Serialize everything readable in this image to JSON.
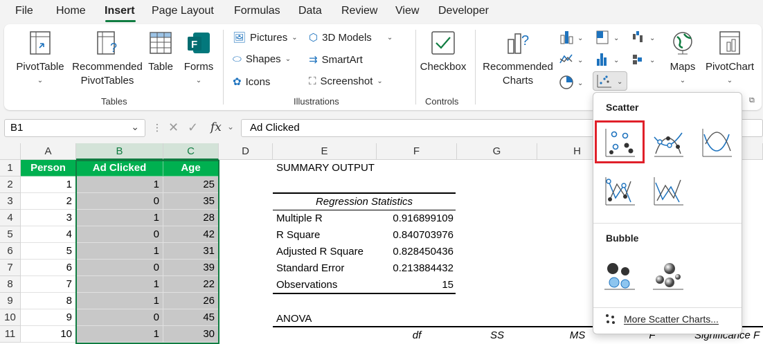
{
  "menu": {
    "tabs": [
      "File",
      "Home",
      "Insert",
      "Page Layout",
      "Formulas",
      "Data",
      "Review",
      "View",
      "Developer"
    ],
    "active": "Insert"
  },
  "ribbon": {
    "pivottable": "PivotTable",
    "rec_pivot_1": "Recommended",
    "rec_pivot_2": "PivotTables",
    "table": "Table",
    "forms": "Forms",
    "tables_group": "Tables",
    "pictures": "Pictures",
    "shapes": "Shapes",
    "icons": "Icons",
    "models": "3D Models",
    "smartart": "SmartArt",
    "screenshot": "Screenshot",
    "illustrations_group": "Illustrations",
    "checkbox": "Checkbox",
    "controls_group": "Controls",
    "rec_charts_1": "Recommended",
    "rec_charts_2": "Charts",
    "maps": "Maps",
    "pivotchart": "PivotChart"
  },
  "formula_bar": {
    "name_box": "B1",
    "fx": "fx",
    "formula": "Ad Clicked"
  },
  "columns": [
    "A",
    "B",
    "C",
    "D",
    "E",
    "F",
    "G",
    "H"
  ],
  "rows": [
    "1",
    "2",
    "3",
    "4",
    "5",
    "6",
    "7",
    "8",
    "9",
    "10",
    "11"
  ],
  "table": {
    "headers": [
      "Person",
      "Ad Clicked",
      "Age"
    ],
    "data": [
      [
        "1",
        "1",
        "25"
      ],
      [
        "2",
        "0",
        "35"
      ],
      [
        "3",
        "1",
        "28"
      ],
      [
        "4",
        "0",
        "42"
      ],
      [
        "5",
        "1",
        "31"
      ],
      [
        "6",
        "0",
        "39"
      ],
      [
        "7",
        "1",
        "22"
      ],
      [
        "8",
        "1",
        "26"
      ],
      [
        "9",
        "0",
        "45"
      ],
      [
        "10",
        "1",
        "30"
      ]
    ]
  },
  "summary": {
    "title": "SUMMARY OUTPUT",
    "reg_title": "Regression Statistics",
    "stats": [
      [
        "Multiple R",
        "0.916899109"
      ],
      [
        "R Square",
        "0.840703976"
      ],
      [
        "Adjusted R Square",
        "0.828450436"
      ],
      [
        "Standard Error",
        "0.213884432"
      ],
      [
        "Observations",
        "15"
      ]
    ],
    "anova": "ANOVA",
    "anova_headers": [
      "df",
      "SS",
      "MS",
      "F",
      "Significance F"
    ]
  },
  "dropdown": {
    "scatter_title": "Scatter",
    "bubble_title": "Bubble",
    "more": "More Scatter Charts...",
    "highlight_color": "#e0202a"
  }
}
